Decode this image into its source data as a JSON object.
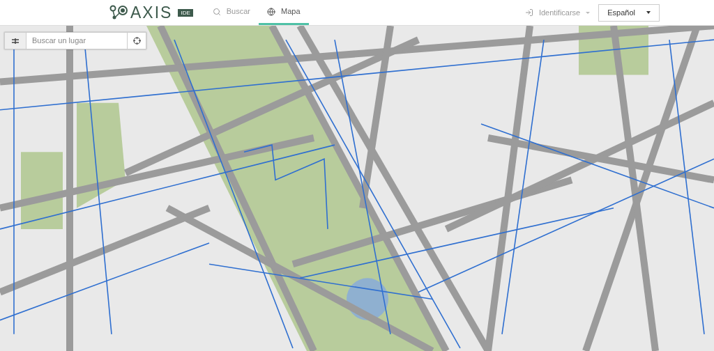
{
  "header": {
    "logo": {
      "text": "AXIS",
      "badge": "IDE"
    },
    "nav": [
      {
        "label": "Buscar",
        "selected": false
      },
      {
        "label": "Mapa",
        "selected": true
      }
    ],
    "login": {
      "label": "Identificarse"
    },
    "language": {
      "value": "Español"
    }
  },
  "map": {
    "search": {
      "placeholder": "Buscar un lugar"
    }
  }
}
